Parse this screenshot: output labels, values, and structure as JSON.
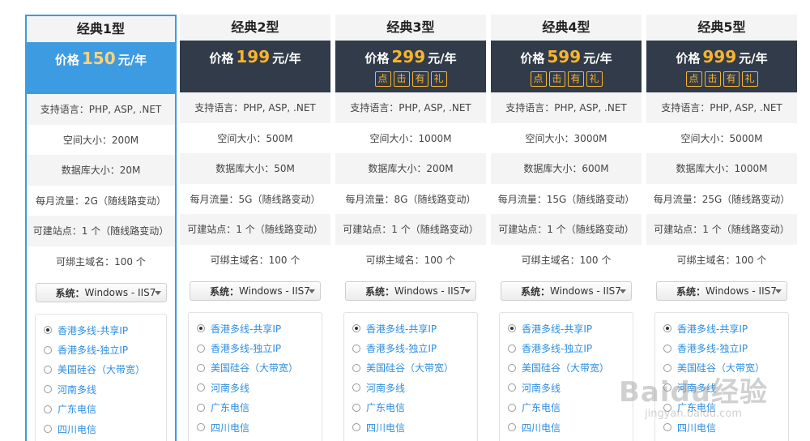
{
  "plans": [
    {
      "title": "经典1型",
      "price_prefix": "价格",
      "price": "150",
      "price_unit": "元/年",
      "selected": true,
      "promo": [],
      "specs": [
        "支持语言：PHP, ASP, .NET",
        "空间大小：200M",
        "数据库大小：20M",
        "每月流量：2G（随线路变动）",
        "可建站点：1 个（随线路变动）",
        "可绑主域名：100 个"
      ],
      "os_label": "系统：",
      "os_value": "Windows - IIS7",
      "lines": [
        "香港多线-共享IP",
        "香港多线-独立IP",
        "美国硅谷（大带宽）",
        "河南多线",
        "广东电信",
        "四川电信"
      ],
      "checked_line": 0
    },
    {
      "title": "经典2型",
      "price_prefix": "价格",
      "price": "199",
      "price_unit": "元/年",
      "selected": false,
      "promo": [],
      "specs": [
        "支持语言：PHP, ASP, .NET",
        "空间大小：500M",
        "数据库大小：50M",
        "每月流量：5G（随线路变动）",
        "可建站点：1 个（随线路变动）",
        "可绑主域名：100 个"
      ],
      "os_label": "系统：",
      "os_value": "Windows - IIS7",
      "lines": [
        "香港多线-共享IP",
        "香港多线-独立IP",
        "美国硅谷（大带宽）",
        "河南多线",
        "广东电信",
        "四川电信"
      ],
      "checked_line": 0
    },
    {
      "title": "经典3型",
      "price_prefix": "价格",
      "price": "299",
      "price_unit": "元/年",
      "selected": false,
      "promo": [
        "点",
        "击",
        "有",
        "礼"
      ],
      "specs": [
        "支持语言：PHP, ASP, .NET",
        "空间大小：1000M",
        "数据库大小：200M",
        "每月流量：8G（随线路变动）",
        "可建站点：1 个（随线路变动）",
        "可绑主域名：100 个"
      ],
      "os_label": "系统：",
      "os_value": "Windows - IIS7",
      "lines": [
        "香港多线-共享IP",
        "香港多线-独立IP",
        "美国硅谷（大带宽）",
        "河南多线",
        "广东电信",
        "四川电信"
      ],
      "checked_line": 0
    },
    {
      "title": "经典4型",
      "price_prefix": "价格",
      "price": "599",
      "price_unit": "元/年",
      "selected": false,
      "promo": [
        "点",
        "击",
        "有",
        "礼"
      ],
      "specs": [
        "支持语言：PHP, ASP, .NET",
        "空间大小：3000M",
        "数据库大小：600M",
        "每月流量：15G（随线路变动）",
        "可建站点：1 个（随线路变动）",
        "可绑主域名：100 个"
      ],
      "os_label": "系统：",
      "os_value": "Windows - IIS7",
      "lines": [
        "香港多线-共享IP",
        "香港多线-独立IP",
        "美国硅谷（大带宽）",
        "河南多线",
        "广东电信",
        "四川电信"
      ],
      "checked_line": 0
    },
    {
      "title": "经典5型",
      "price_prefix": "价格",
      "price": "999",
      "price_unit": "元/年",
      "selected": false,
      "promo": [
        "点",
        "击",
        "有",
        "礼"
      ],
      "specs": [
        "支持语言：PHP, ASP, .NET",
        "空间大小：5000M",
        "数据库大小：1000M",
        "每月流量：25G（随线路变动）",
        "可建站点：1 个（随线路变动）",
        "可绑主域名：100 个"
      ],
      "os_label": "系统：",
      "os_value": "Windows - IIS7",
      "lines": [
        "香港多线-共享IP",
        "香港多线-独立IP",
        "美国硅谷（大带宽）",
        "河南多线",
        "广东电信",
        "四川电信"
      ],
      "checked_line": 0
    }
  ],
  "watermark": {
    "main": "Baidu经验",
    "sub": "jingyan.baidu.com"
  },
  "colors": {
    "selected_accent": "#3d9be2",
    "dark_header": "#323b4a",
    "price_highlight": "#f7b52c",
    "link_blue": "#2d8ee0"
  }
}
